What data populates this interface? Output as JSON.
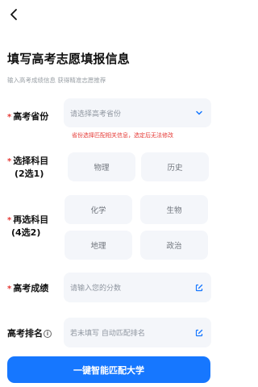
{
  "header": {
    "back_icon": "back-arrow-icon"
  },
  "page": {
    "title": "填写高考志愿填报信息",
    "subtitle": "输入高考成绩信息 获得精准志愿推荐"
  },
  "province": {
    "required_mark": "*",
    "label": "高考省份",
    "placeholder": "请选择高考省份",
    "hint": "省份选择匹配相关信息，选定后无法修改",
    "icon": "chevron-down-icon"
  },
  "subjects_primary": {
    "required_mark": "*",
    "label_line1": "选择科目",
    "label_line2": "(2选1)",
    "options": [
      "物理",
      "历史"
    ]
  },
  "subjects_secondary": {
    "required_mark": "*",
    "label_line1": "再选科目",
    "label_line2": "(4选2)",
    "options": [
      "化学",
      "生物",
      "地理",
      "政治"
    ]
  },
  "score": {
    "required_mark": "*",
    "label": "高考成绩",
    "placeholder": "请输入您的分数",
    "icon": "edit-icon"
  },
  "rank": {
    "label": "高考排名",
    "info_icon": "info-icon",
    "placeholder": "若未填写 自动匹配排名",
    "icon": "edit-icon"
  },
  "cta": {
    "label": "一键智能匹配大学"
  },
  "colors": {
    "accent": "#1677ff",
    "required": "#e53935",
    "field_bg": "#f4f6fa"
  }
}
